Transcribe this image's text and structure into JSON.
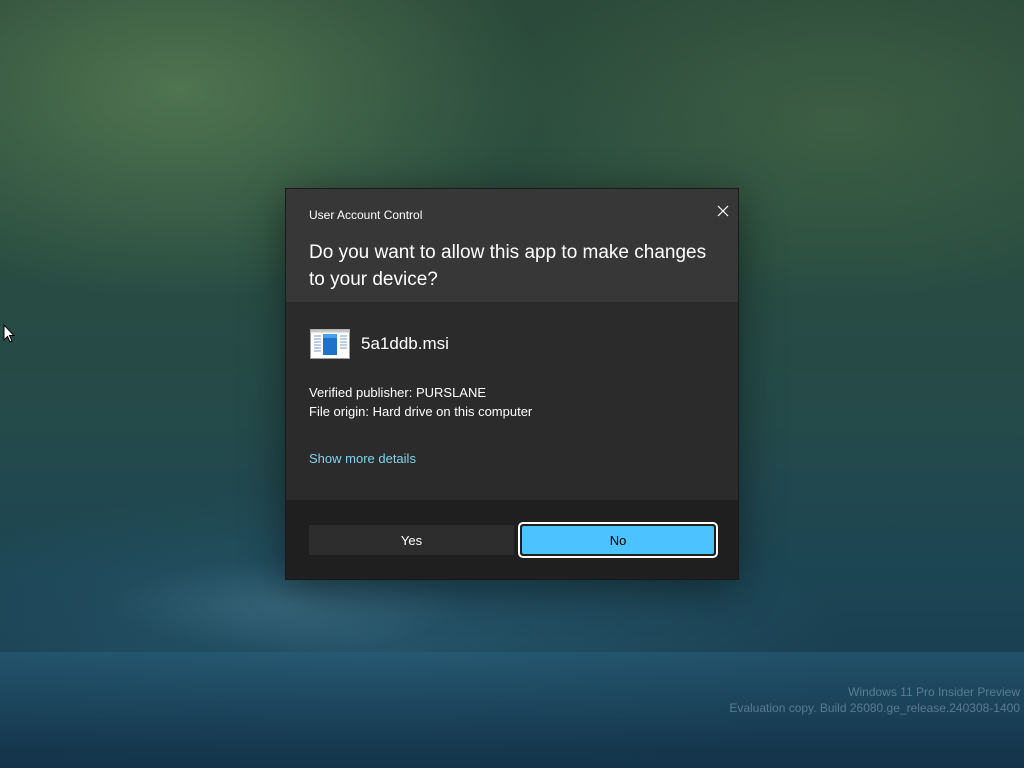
{
  "desktop": {
    "watermark": {
      "line1": "Windows 11 Pro Insider Preview",
      "line2": "Evaluation copy. Build 26080.ge_release.240308-1400"
    }
  },
  "dialog": {
    "title": "User Account Control",
    "question": "Do you want to allow this app to make changes to your device?",
    "app_name": "5a1ddb.msi",
    "publisher": "Verified publisher: PURSLANE",
    "origin": "File origin: Hard drive on this computer",
    "details_link": "Show more details",
    "yes_label": "Yes",
    "no_label": "No",
    "close_icon": "close-icon",
    "app_icon": "installer-package-icon"
  },
  "colors": {
    "dialog_bg": "#2b2b2b",
    "header_bg": "#373737",
    "footer_bg": "#1f1f1f",
    "link": "#7fd5ea",
    "accent_button": "#4cc2ff"
  }
}
